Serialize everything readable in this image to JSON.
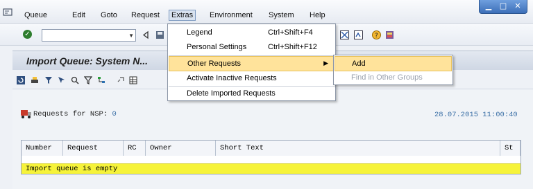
{
  "menubar": {
    "items": [
      "Queue",
      "Edit",
      "Goto",
      "Request",
      "Extras",
      "Environment",
      "System",
      "Help"
    ],
    "active": "Extras"
  },
  "window_controls": {
    "minimize": "▁",
    "maximize": "□",
    "close": "✕"
  },
  "toolbar": {
    "command_value": ""
  },
  "screen": {
    "title": "Import Queue: System N..."
  },
  "content": {
    "requests_label": "Requests for NSP:",
    "requests_count": "0",
    "timestamp": "28.07.2015 11:00:40",
    "table": {
      "columns": [
        "Number",
        "Request",
        "RC",
        "Owner",
        "Short Text",
        "St"
      ],
      "empty_message": "Import queue is empty"
    }
  },
  "extras_menu": {
    "items": [
      {
        "label": "Legend",
        "shortcut": "Ctrl+Shift+F4"
      },
      {
        "label": "Personal Settings",
        "shortcut": "Ctrl+Shift+F12"
      },
      {
        "label": "Other Requests",
        "shortcut": ""
      },
      {
        "label": "Activate Inactive Requests",
        "shortcut": ""
      },
      {
        "label": "Delete Imported Requests",
        "shortcut": ""
      }
    ]
  },
  "submenu": {
    "items": [
      {
        "label": "Add",
        "enabled": true
      },
      {
        "label": "Find in Other Groups",
        "enabled": false
      }
    ]
  },
  "colors": {
    "highlight": "#ffe39b",
    "empty_row": "#f6f33a",
    "accent": "#3a6fa6"
  }
}
